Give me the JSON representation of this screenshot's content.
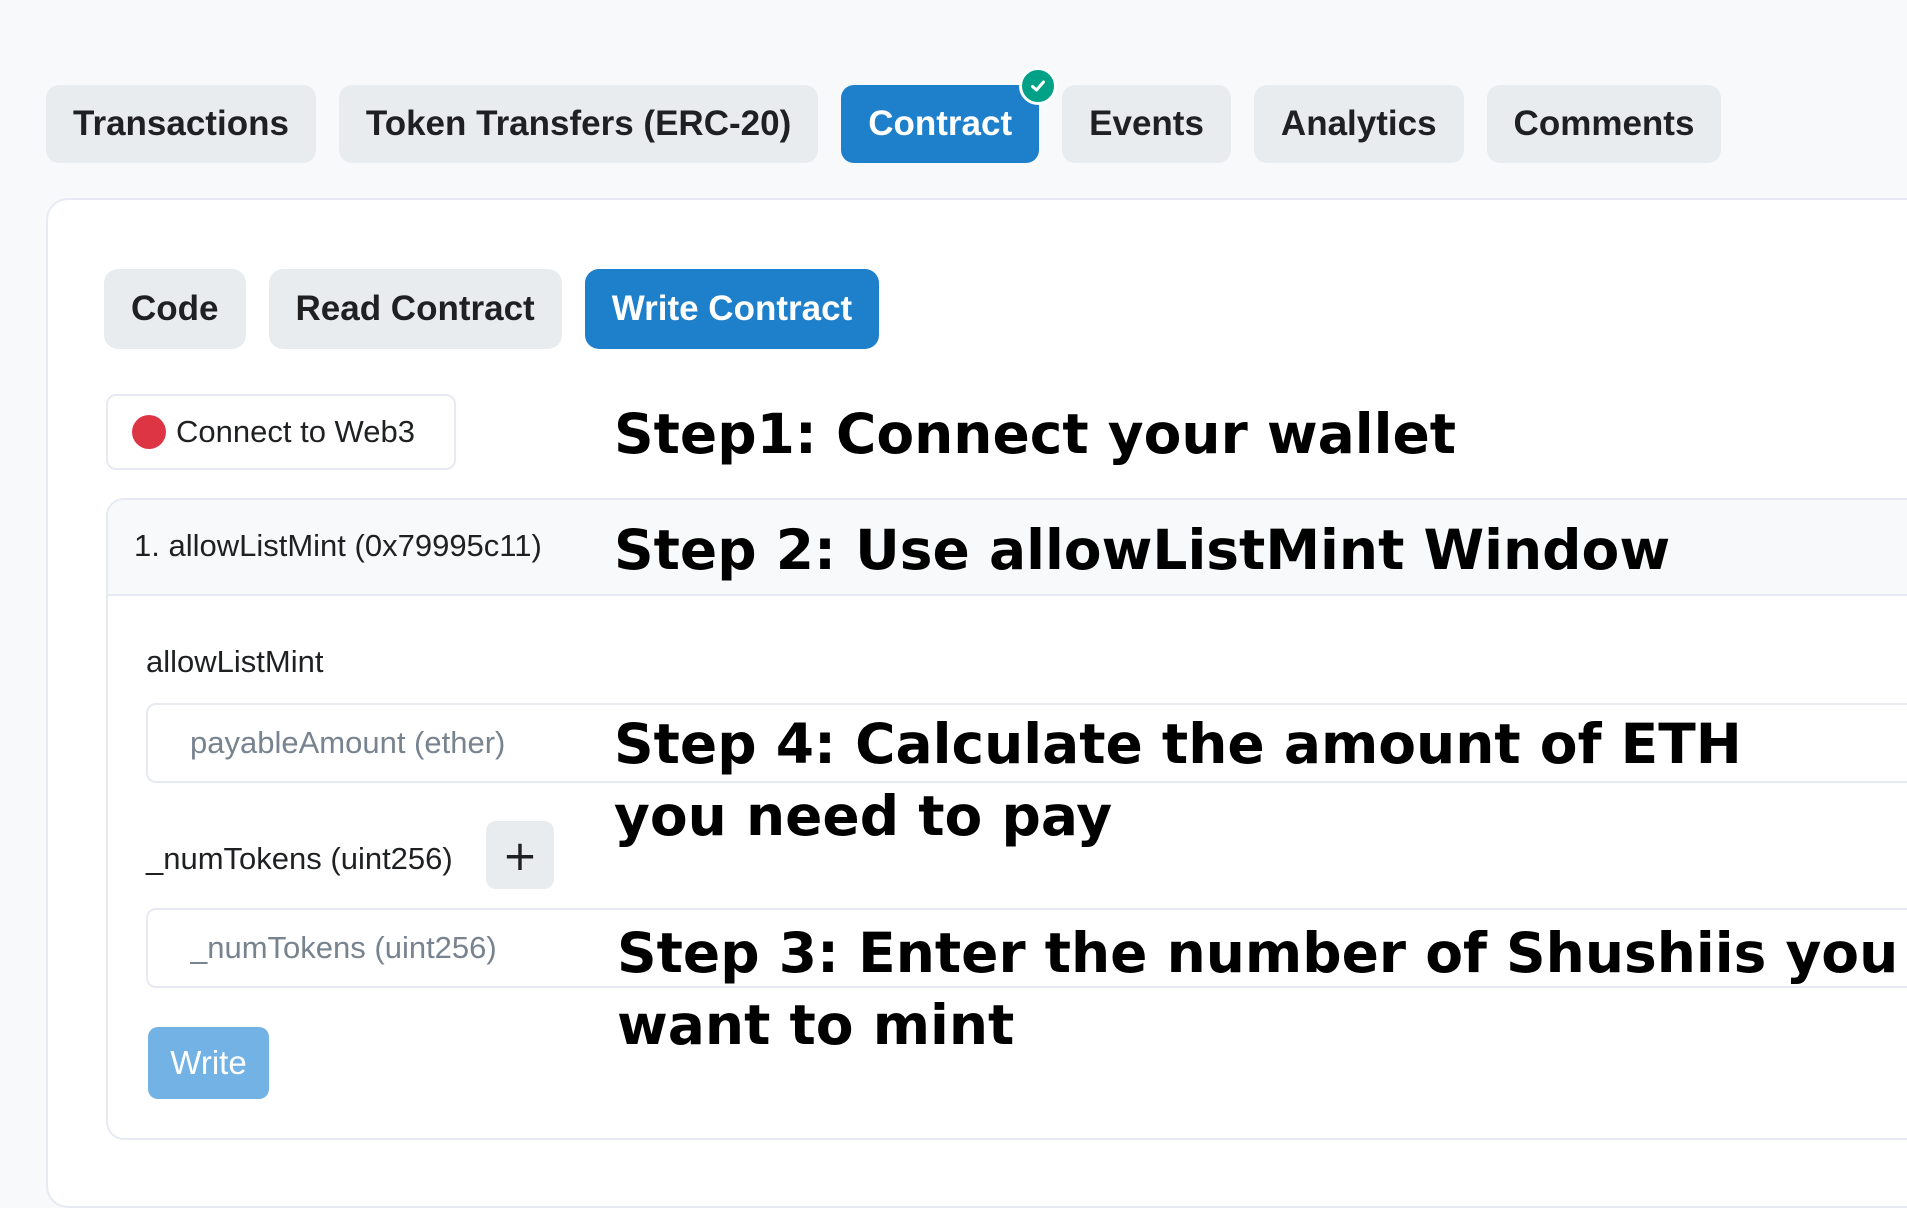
{
  "top_tabs": [
    {
      "label": "Transactions"
    },
    {
      "label": "Token Transfers (ERC-20)"
    },
    {
      "label": "Contract"
    },
    {
      "label": "Events"
    },
    {
      "label": "Analytics"
    },
    {
      "label": "Comments"
    }
  ],
  "active_top_tab": "Contract",
  "sub_tabs": [
    {
      "label": "Code"
    },
    {
      "label": "Read Contract"
    },
    {
      "label": "Write Contract"
    }
  ],
  "active_sub_tab": "Write Contract",
  "connect": {
    "label": "Connect to Web3",
    "status_color": "#de3545"
  },
  "function": {
    "title": "1. allowListMint (0x79995c11)",
    "name": "allowListMint",
    "payable_placeholder": "payableAmount (ether)",
    "param_label": "_numTokens (uint256)",
    "param_placeholder": "_numTokens (uint256)",
    "plus_label": "+",
    "write_label": "Write"
  },
  "annotations": {
    "step1": "Step1: Connect your wallet",
    "step2": "Step 2: Use allowListMint Window",
    "step4_line1": "Step 4: Calculate the amount of ETH",
    "step4_line2": "you need to pay",
    "step3_line1": "Step 3: Enter the number of Shushiis you",
    "step3_line2": "want to mint"
  },
  "colors": {
    "accent": "#1e7fcb",
    "verified": "#00a186",
    "write_disabled": "#72b2e4"
  }
}
